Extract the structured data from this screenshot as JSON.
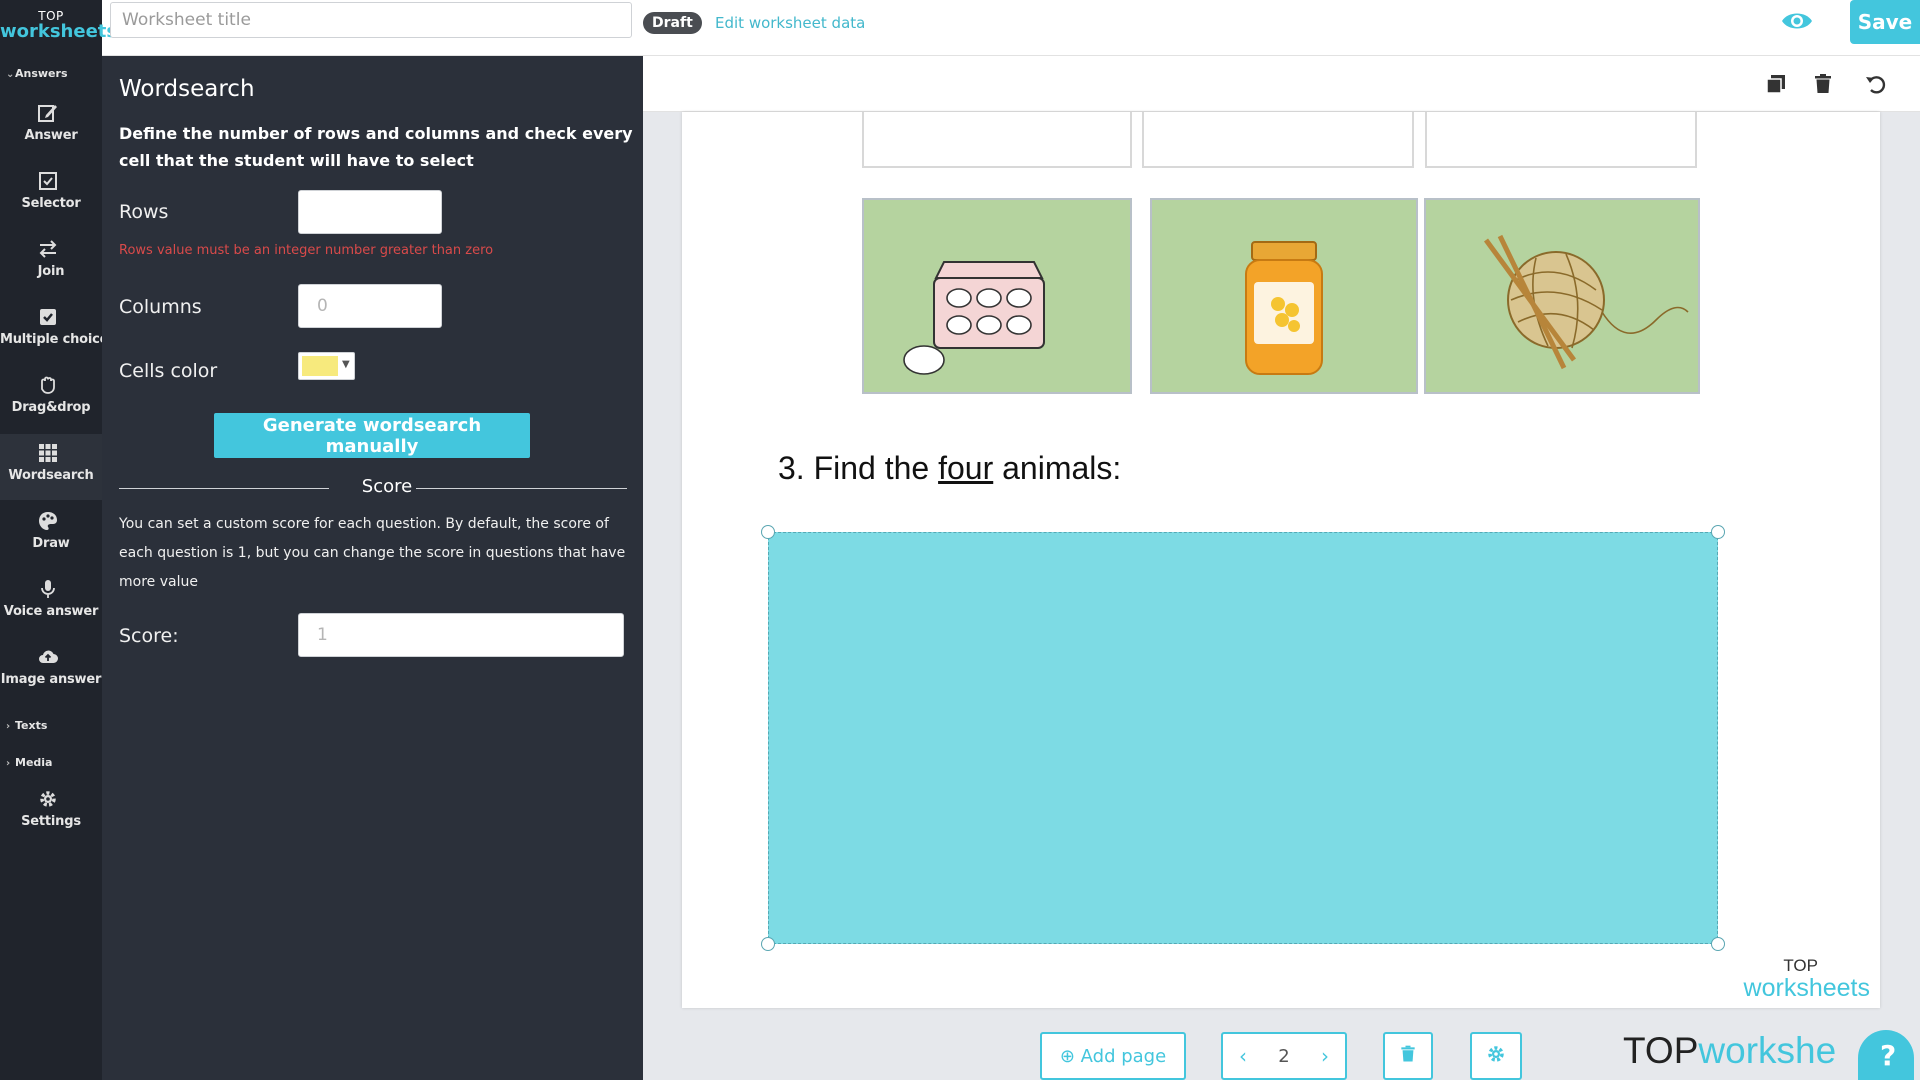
{
  "logo": {
    "line1": "TOP",
    "line2": "worksheets"
  },
  "header": {
    "title_placeholder": "Worksheet title",
    "status_badge": "Draft",
    "edit_data_link": "Edit worksheet data",
    "save_label": "Save",
    "preview_icon": "eye-icon"
  },
  "sidebar": {
    "sections": {
      "answers": "Answers",
      "texts": "Texts",
      "media": "Media"
    },
    "items": [
      {
        "label": "Answer",
        "icon": "edit-icon"
      },
      {
        "label": "Selector",
        "icon": "checkbox-icon"
      },
      {
        "label": "Join",
        "icon": "arrows-exchange-icon"
      },
      {
        "label": "Multiple choice",
        "icon": "checked-box-icon"
      },
      {
        "label": "Drag&drop",
        "icon": "hand-icon"
      },
      {
        "label": "Wordsearch",
        "icon": "grid-icon"
      },
      {
        "label": "Draw",
        "icon": "palette-icon"
      },
      {
        "label": "Voice answer",
        "icon": "microphone-icon"
      },
      {
        "label": "Image answer",
        "icon": "cloud-upload-icon"
      },
      {
        "label": "Settings",
        "icon": "gear-icon"
      }
    ],
    "active_item": "Wordsearch"
  },
  "panel": {
    "title": "Wordsearch",
    "description": "Define the number of rows and columns and check every cell that the student will have to select",
    "rows_label": "Rows",
    "rows_value": "",
    "rows_error": "Rows value must be an integer number greater than zero",
    "columns_label": "Columns",
    "columns_placeholder": "0",
    "cells_color_label": "Cells color",
    "cells_color": "#f7ea7d",
    "generate_button": "Generate wordsearch manually",
    "score_heading": "Score",
    "score_description": "You can set a custom score for each question. By default, the score of each question is 1, but you can change the score in questions that have more value",
    "score_label": "Score:",
    "score_placeholder": "1"
  },
  "toolbar": {
    "icons": [
      "copy-icon",
      "trash-icon",
      "undo-icon"
    ]
  },
  "worksheet": {
    "images": [
      "egg-carton-image",
      "honey-jar-image",
      "yarn-ball-image"
    ],
    "question": {
      "before": "3. Find the ",
      "underlined": "four",
      "after": " animals:"
    },
    "block_color": "#7ddbe4",
    "watermark": {
      "line1": "TOP",
      "line2": "worksheets"
    }
  },
  "footer": {
    "add_page_label": "Add page",
    "page_number": "2",
    "brand_top": "TOP",
    "brand_rest": "workshe"
  },
  "colors": {
    "accent": "#43c6dd",
    "sidebar_bg": "#20242c",
    "panel_bg": "#2b303a",
    "error": "#d94a4a"
  }
}
